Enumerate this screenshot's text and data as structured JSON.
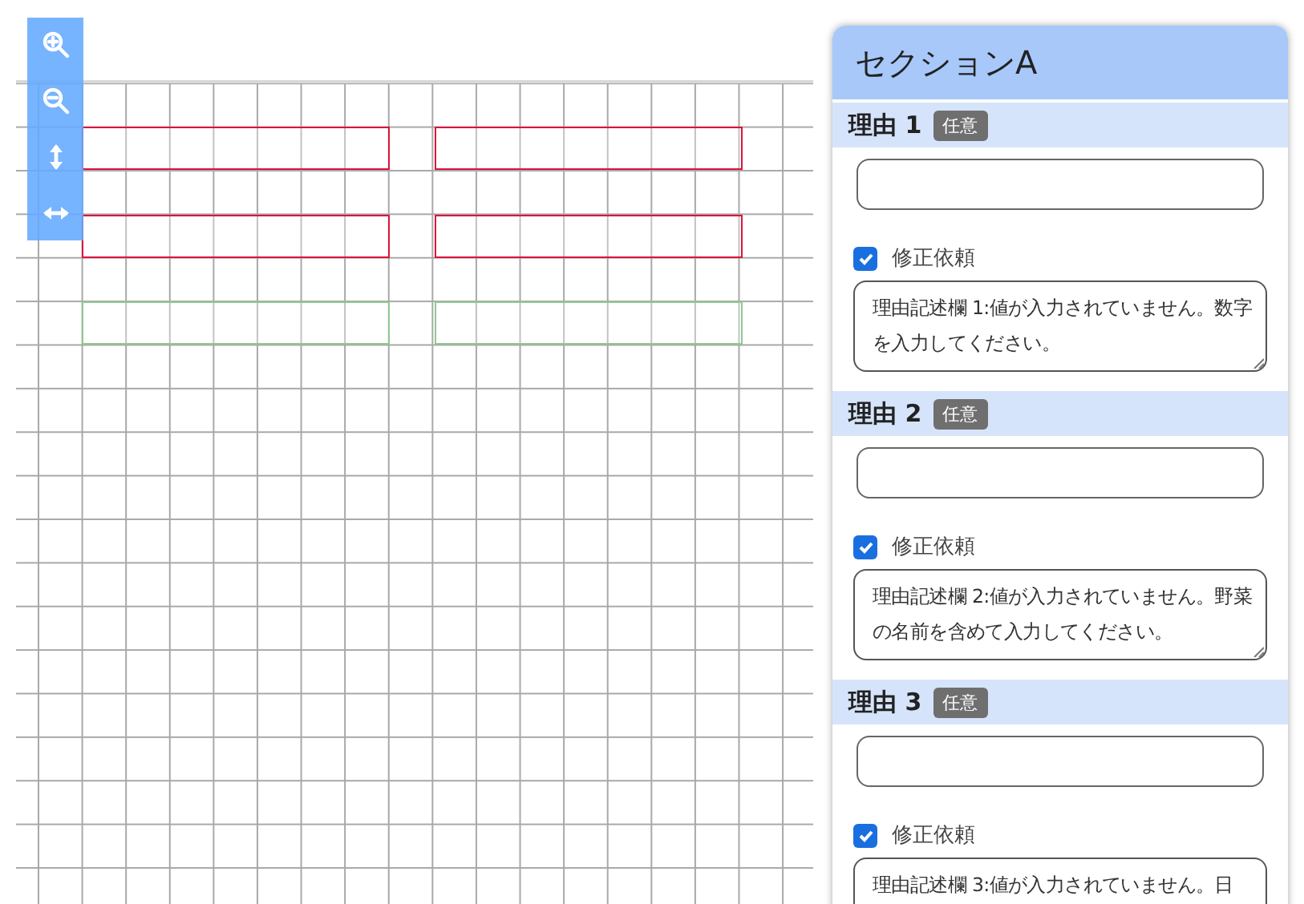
{
  "toolbar": {
    "tools": [
      {
        "kind": "zoom-in"
      },
      {
        "kind": "zoom-out"
      },
      {
        "kind": "fit-height"
      },
      {
        "kind": "fit-width"
      }
    ]
  },
  "canvas": {
    "fields": [
      {
        "color": "#dc143c"
      },
      {
        "color": "#dc143c"
      },
      {
        "color": "#dc143c"
      },
      {
        "color": "#dc143c"
      },
      {
        "color": "#8fc98f"
      },
      {
        "color": "#8fc98f"
      }
    ]
  },
  "panel": {
    "title": "セクションA",
    "items": [
      {
        "label": "理由 1",
        "badge": "任意",
        "checkbox_label": "修正依頼",
        "checked": true,
        "comment": "理由記述欄 1:値が入力されていません。数字を入力してください。"
      },
      {
        "label": "理由 2",
        "badge": "任意",
        "checkbox_label": "修正依頼",
        "checked": true,
        "comment": "理由記述欄 2:値が入力されていません。野菜の名前を含めて入力してください。"
      },
      {
        "label": "理由 3",
        "badge": "任意",
        "checkbox_label": "修正依頼",
        "checked": true,
        "comment": "理由記述欄 3:値が入力されていません。日"
      }
    ]
  }
}
